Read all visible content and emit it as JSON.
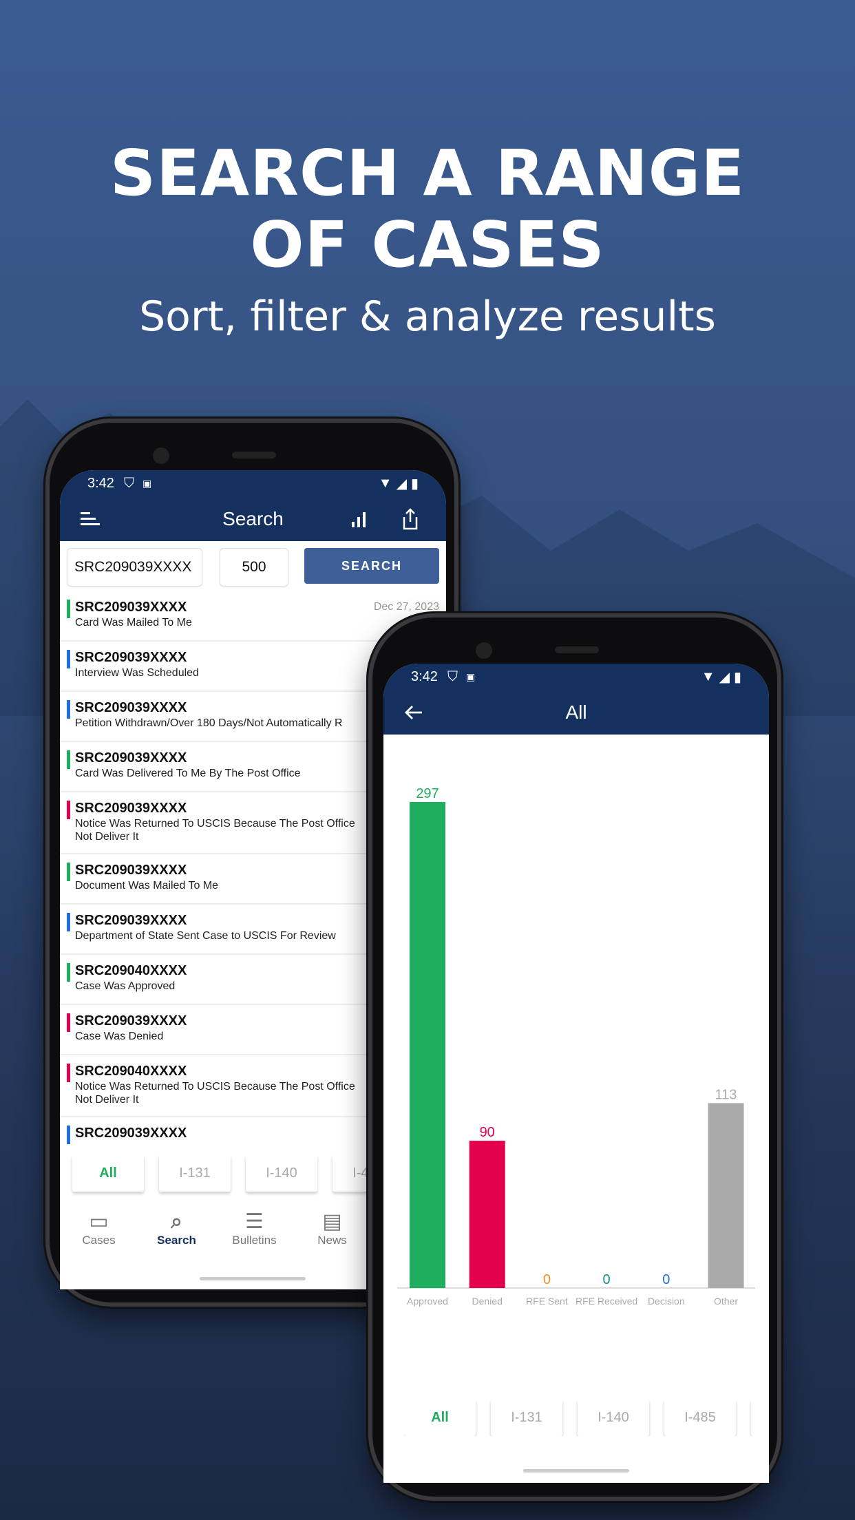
{
  "hero": {
    "title_line1": "SEARCH A RANGE",
    "title_line2": "OF CASES",
    "subtitle": "Sort, filter & analyze results"
  },
  "colors": {
    "approved": "#1fae5e",
    "denied": "#e3004c",
    "rfe_sent": "#f0902a",
    "rfe_received": "#178a86",
    "decision": "#1e6fd0",
    "other": "#aaaaaa",
    "appbar": "#14305f",
    "blue": "#1e6fe0"
  },
  "search_screen": {
    "status_time": "3:42",
    "title": "Search",
    "icons": [
      "menu-icon",
      "bar-chart-icon",
      "share-icon"
    ],
    "receipt_input": "SRC209039XXXX",
    "count_input": "500",
    "search_button": "SEARCH",
    "cases": [
      {
        "id": "SRC209039XXXX",
        "status": "Card Was Mailed To Me",
        "date": "Dec 27, 2023",
        "color": "approved"
      },
      {
        "id": "SRC209039XXXX",
        "status": "Interview Was Scheduled",
        "color": "blue"
      },
      {
        "id": "SRC209039XXXX",
        "status": "Petition Withdrawn/Over 180 Days/Not Automatically R",
        "color": "blue"
      },
      {
        "id": "SRC209039XXXX",
        "status": "Card Was Delivered To Me By The Post Office",
        "color": "approved"
      },
      {
        "id": "SRC209039XXXX",
        "status": "Notice Was Returned To USCIS Because The Post Office",
        "status2": "Not Deliver It",
        "color": "denied"
      },
      {
        "id": "SRC209039XXXX",
        "status": "Document Was Mailed To Me",
        "color": "approved"
      },
      {
        "id": "SRC209039XXXX",
        "status": "Department of State Sent Case to USCIS For Review",
        "color": "blue"
      },
      {
        "id": "SRC209040XXXX",
        "status": "Case Was Approved",
        "color": "approved"
      },
      {
        "id": "SRC209039XXXX",
        "status": "Case Was Denied",
        "color": "denied"
      },
      {
        "id": "SRC209040XXXX",
        "status": "Notice Was Returned To USCIS Because The Post Office",
        "status2": "Not Deliver It",
        "color": "denied"
      },
      {
        "id": "SRC209039XXXX",
        "status": "",
        "color": "blue"
      }
    ],
    "chips": [
      "All",
      "I-131",
      "I-140",
      "I-485"
    ],
    "nav": [
      {
        "label": "Cases",
        "icon": "cases-icon"
      },
      {
        "label": "Search",
        "icon": "search-icon",
        "active": true
      },
      {
        "label": "Bulletins",
        "icon": "list-icon"
      },
      {
        "label": "News",
        "icon": "news-icon"
      }
    ]
  },
  "chart_screen": {
    "status_time": "3:42",
    "title": "All",
    "chips": [
      "All",
      "I-131",
      "I-140",
      "I-485",
      "I"
    ]
  },
  "chart_data": {
    "type": "bar",
    "categories": [
      "Approved",
      "Denied",
      "RFE Sent",
      "RFE Received",
      "Decision",
      "Other"
    ],
    "values": [
      297,
      90,
      0,
      0,
      0,
      113
    ],
    "colors": [
      "#1fae5e",
      "#e3004c",
      "#f0902a",
      "#178a86",
      "#1e6fd0",
      "#aaaaaa"
    ],
    "ylim": [
      0,
      297
    ],
    "grid": false
  }
}
